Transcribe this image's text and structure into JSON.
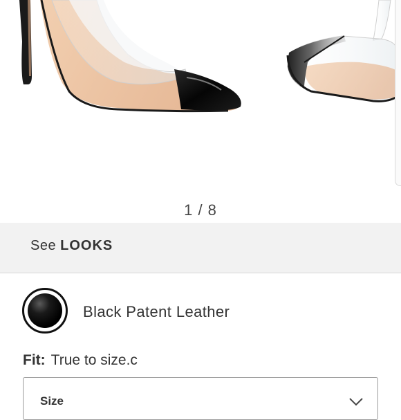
{
  "gallery": {
    "counter": "1 / 8",
    "image_alt": "Black patent leather clear PVC pointed-toe pumps"
  },
  "looks": {
    "prefix": "See",
    "label": "LOOKS"
  },
  "color": {
    "name": "Black Patent Leather",
    "swatch_color": "#000000"
  },
  "fit": {
    "label": "Fit:",
    "value": "True to size.c"
  },
  "size_select": {
    "label": "Size"
  },
  "colors": {
    "looks_bg": "#f2f2f2",
    "text": "#333333"
  }
}
